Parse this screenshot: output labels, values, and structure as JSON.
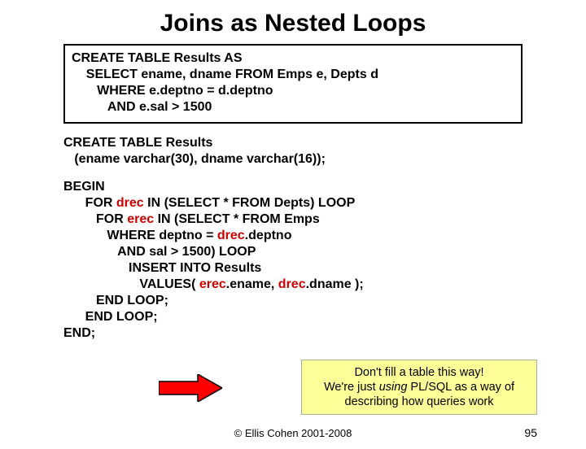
{
  "title": "Joins as Nested Loops",
  "sql_box": {
    "line1": "CREATE TABLE Results AS",
    "line2": "    SELECT ename, dname FROM Emps e, Depts d",
    "line3": "       WHERE e.deptno = d.deptno",
    "line4": "          AND e.sal > 1500"
  },
  "create_table": {
    "line1": "CREATE TABLE Results",
    "line2": "   (ename varchar(30), dname varchar(16));"
  },
  "plsql": {
    "l1": "BEGIN",
    "l2a": "      FOR ",
    "l2b_red": "drec",
    "l2c": " IN (SELECT * FROM Depts) LOOP",
    "l3a": "         FOR ",
    "l3b_red": "erec",
    "l3c": " IN (SELECT * FROM Emps",
    "l4a": "            WHERE deptno = ",
    "l4b_red": "drec",
    "l4c": ".deptno",
    "l5": "               AND sal > 1500) LOOP",
    "l6": "                  INSERT INTO Results",
    "l7a": "                     VALUES( ",
    "l7b_red": "erec",
    "l7c": ".ename, ",
    "l7d_red": "drec",
    "l7e": ".dname );",
    "l8": "         END LOOP;",
    "l9": "      END LOOP;",
    "l10": "END;"
  },
  "note": {
    "line1": "Don't fill a table this way!",
    "line2a": "We're just ",
    "line2b_italic": "using",
    "line2c": " PL/SQL as a way of",
    "line3": "describing how queries work"
  },
  "footer": "© Ellis Cohen 2001-2008",
  "page_number": "95"
}
